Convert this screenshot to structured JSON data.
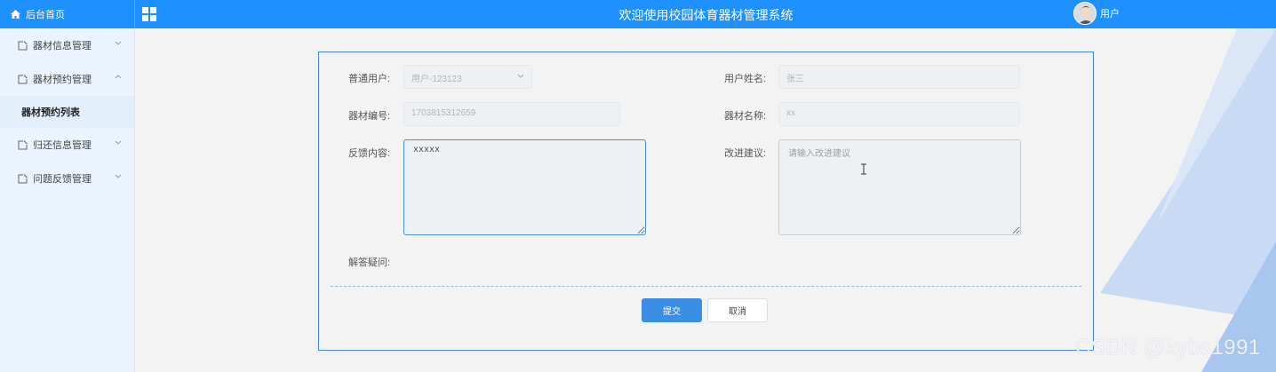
{
  "header": {
    "brand": "后台首页",
    "title": "欢迎使用校园体育器材管理系统",
    "user_label": "用户"
  },
  "sidebar": {
    "items": [
      {
        "label": "器材信息管理"
      },
      {
        "label": "器材预约管理"
      },
      {
        "label": "器材预约列表"
      },
      {
        "label": "归还信息管理"
      },
      {
        "label": "问题反馈管理"
      }
    ]
  },
  "form": {
    "user_label": "普通用户:",
    "user_value": "用户-123123",
    "name_label": "用户姓名:",
    "name_value": "张三",
    "code_label": "器材编号:",
    "code_value": "1703815312659",
    "equip_label": "器材名称:",
    "equip_value": "xx",
    "feedback_label": "反馈内容:",
    "feedback_value": "xxxxx",
    "suggest_label": "改进建议:",
    "suggest_placeholder": "请输入改进建议",
    "answer_label": "解答疑问:",
    "submit_label": "提交",
    "cancel_label": "取消"
  },
  "watermark": "CSDN @kybs1991",
  "colors": {
    "primary": "#1e90ff",
    "sidebar_bg": "#eaf3fe",
    "button_primary": "#3a8ee6"
  }
}
